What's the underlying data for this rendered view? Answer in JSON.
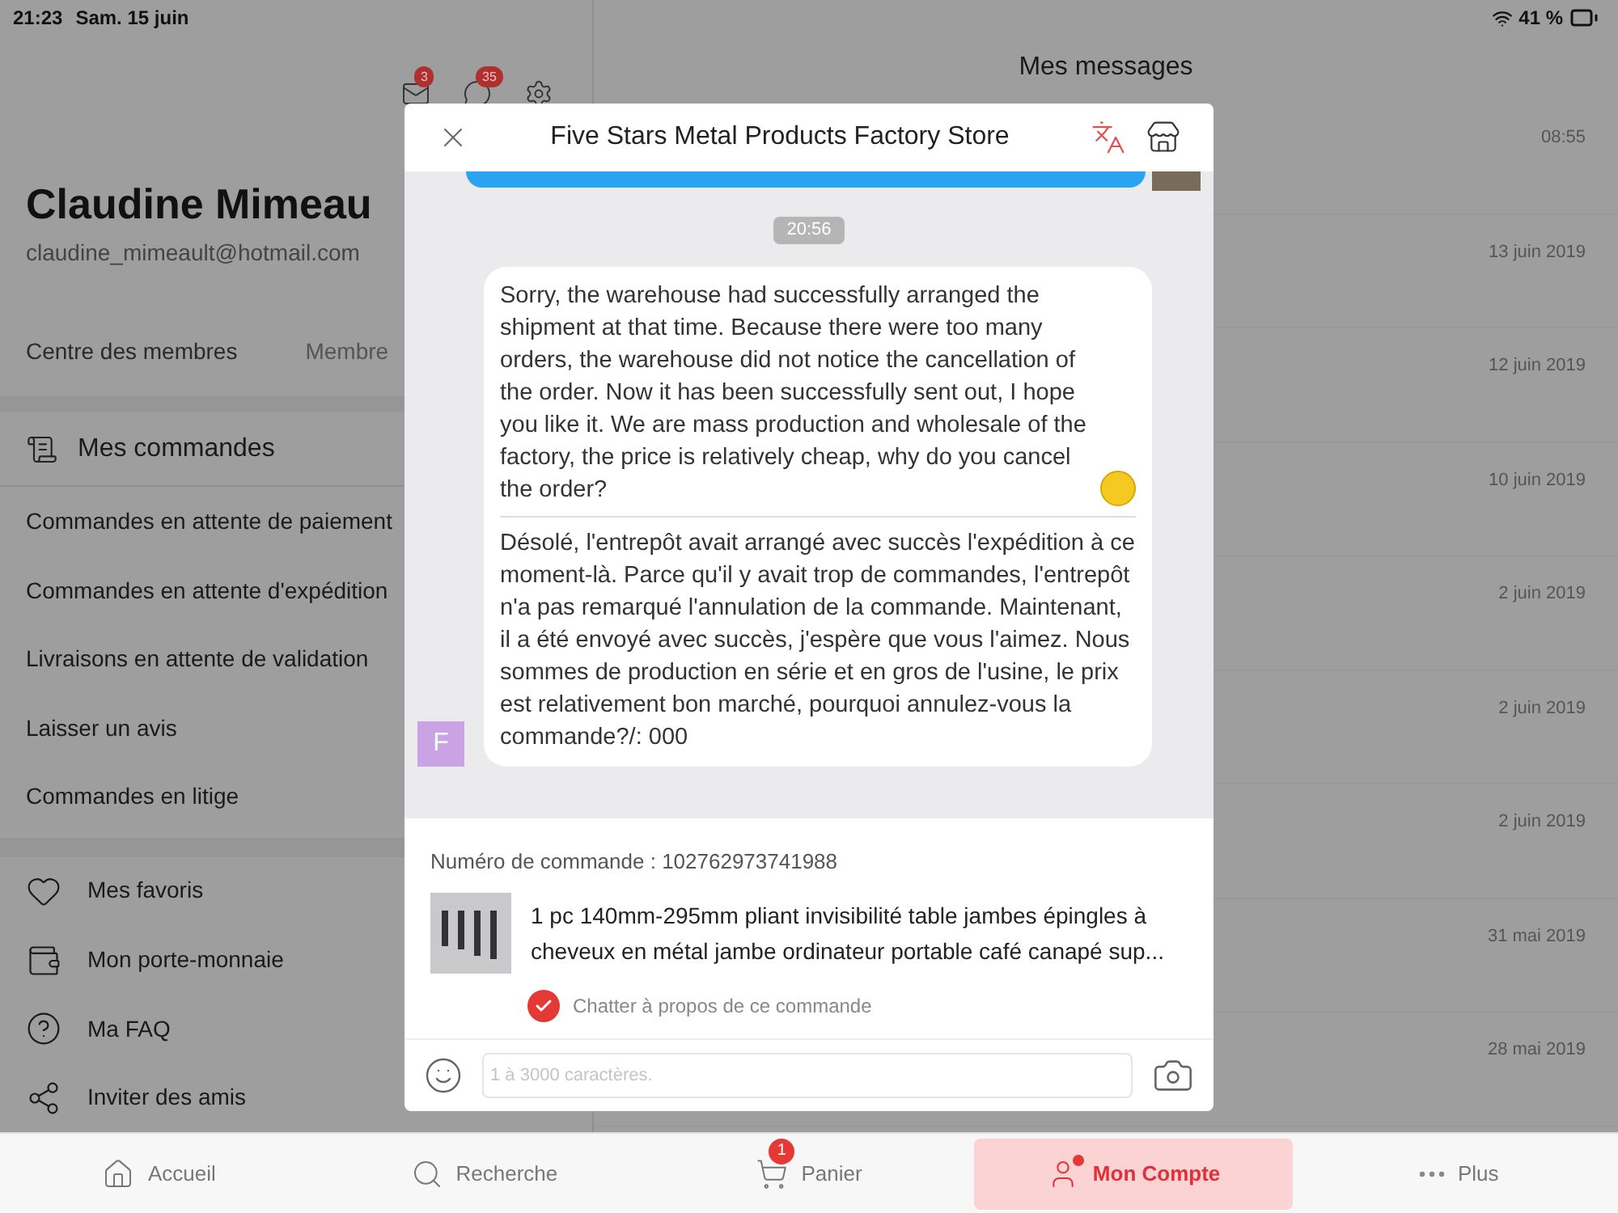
{
  "status_bar": {
    "time": "21:23",
    "date": "Sam. 15 juin",
    "battery": "41 %"
  },
  "account": {
    "mail_badge": "3",
    "chat_badge": "35",
    "name": "Claudine Mimeau",
    "email": "claudine_mimeault@hotmail.com",
    "tabs": [
      "Centre des membres",
      "Membre"
    ]
  },
  "orders": {
    "title": "Mes commandes",
    "items": [
      "Commandes en attente de paiement",
      "Commandes en attente d'expédition",
      "Livraisons en attente de validation",
      "Laisser un avis",
      "Commandes en litige"
    ]
  },
  "links": [
    {
      "kind": "heart",
      "label": "Mes favoris"
    },
    {
      "kind": "wallet",
      "label": "Mon porte-monnaie"
    },
    {
      "kind": "faq",
      "label": "Ma FAQ"
    },
    {
      "kind": "share",
      "label": "Inviter des amis"
    }
  ],
  "messages_panel": {
    "title": "Mes messages",
    "dates": [
      "08:55",
      "13 juin 2019",
      "12 juin 2019",
      "10 juin 2019",
      "2 juin 2019",
      "2 juin 2019",
      "2 juin 2019",
      "31 mai 2019",
      "28 mai 2019"
    ]
  },
  "chat": {
    "title": "Five Stars Metal Products Factory Store",
    "time_divider": "20:56",
    "message": {
      "sender_initial": "F",
      "original": "Sorry, the warehouse had successfully arranged the shipment at that time. Because there were too many orders, the warehouse did not notice the cancellation of the order. Now it has been successfully sent out, I hope you like it. We are mass production and wholesale of the factory, the price is relatively cheap, why do you cancel the order?",
      "translation": "Désolé, l'entrepôt avait arrangé avec succès l'expédition à ce moment-là. Parce qu'il y avait trop de commandes, l'entrepôt n'a pas remarqué l'annulation de la commande. Maintenant, il a été envoyé avec succès, j'espère que vous l'aimez. Nous sommes de production en série et en gros de l'usine, le prix est relativement bon marché, pourquoi annulez-vous la commande?/: 000"
    },
    "order": {
      "label": "Numéro de commande : 102762973741988",
      "product": "1 pc 140mm-295mm pliant invisibilité table jambes épingles à cheveux en métal jambe ordinateur portable café canapé sup...",
      "chat_about": {
        "label": "Chatter à propos de ce commande",
        "checked": true
      }
    },
    "input": {
      "placeholder": "1 à 3000 caractères."
    }
  },
  "nav": [
    {
      "kind": "home",
      "label": "Accueil",
      "selected": false
    },
    {
      "kind": "search",
      "label": "Recherche",
      "selected": false
    },
    {
      "kind": "cart",
      "label": "Panier",
      "badge": "1",
      "selected": false
    },
    {
      "kind": "account",
      "label": "Mon Compte",
      "dot": true,
      "selected": true
    },
    {
      "kind": "more",
      "label": "Plus",
      "selected": false
    }
  ]
}
